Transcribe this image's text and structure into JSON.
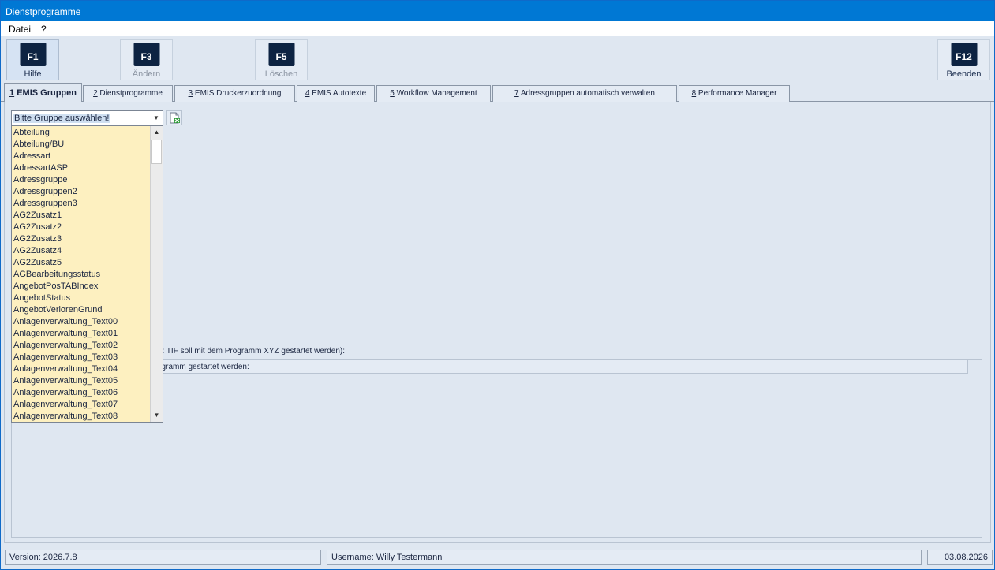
{
  "window": {
    "title": "Dienstprogramme"
  },
  "menu": {
    "items": [
      "Datei",
      "?"
    ]
  },
  "toolbar": {
    "buttons": [
      {
        "key": "F1",
        "label": "Hilfe"
      },
      {
        "key": "F3",
        "label": "Ändern"
      },
      {
        "key": "F5",
        "label": "Löschen"
      },
      {
        "key": "F12",
        "label": "Beenden"
      }
    ]
  },
  "tabs": [
    {
      "num": "1",
      "label": " EMIS Gruppen"
    },
    {
      "num": "2",
      "label": " Dienstprogramme"
    },
    {
      "num": "3",
      "label": " EMIS Druckerzuordnung"
    },
    {
      "num": "4",
      "label": " EMIS Autotexte"
    },
    {
      "num": "5",
      "label": " Workflow Management"
    },
    {
      "num": "7",
      "label": " Adressgruppen automatisch verwalten"
    },
    {
      "num": "8",
      "label": " Performance Manager"
    }
  ],
  "group_select": {
    "placeholder": "Bitte Gruppe auswählen!",
    "options": [
      "Abteilung",
      "Abteilung/BU",
      "Adressart",
      "AdressartASP",
      "Adressgruppe",
      "Adressgruppen2",
      "Adressgruppen3",
      "AG2Zusatz1",
      "AG2Zusatz2",
      "AG2Zusatz3",
      "AG2Zusatz4",
      "AG2Zusatz5",
      "AGBearbeitungsstatus",
      "AngebotPosTABIndex",
      "AngebotStatus",
      "AngebotVerlorenGrund",
      "Anlagenverwaltung_Text00",
      "Anlagenverwaltung_Text01",
      "Anlagenverwaltung_Text02",
      "Anlagenverwaltung_Text03",
      "Anlagenverwaltung_Text04",
      "Anlagenverwaltung_Text05",
      "Anlagenverwaltung_Text06",
      "Anlagenverwaltung_Text07",
      "Anlagenverwaltung_Text08"
    ]
  },
  "hints": {
    "line1": "z.B: TIF soll mit dem Programm XYZ gestartet werden):",
    "line2": "ogramm gestartet werden:"
  },
  "status": {
    "version": "Version: 2026.7.8",
    "user": "Username: Willy Testermann",
    "date": "03.08.2026"
  }
}
